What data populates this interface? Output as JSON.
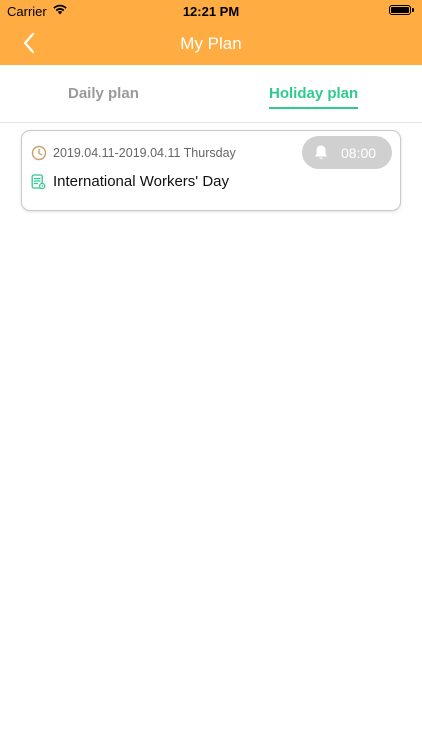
{
  "status_bar": {
    "carrier": "Carrier",
    "time": "12:21 PM"
  },
  "nav": {
    "title": "My Plan",
    "back_icon": "chevron-left-icon",
    "background_color": "#FFAD42"
  },
  "tabs": [
    {
      "label": "Daily plan",
      "active": false
    },
    {
      "label": "Holiday plan",
      "active": true
    }
  ],
  "accent_color": "#2FCB8C",
  "plans": [
    {
      "date_range": "2019.04.11-2019.04.11 Thursday",
      "reminder_time": "08:00",
      "name": "International Workers' Day"
    }
  ]
}
